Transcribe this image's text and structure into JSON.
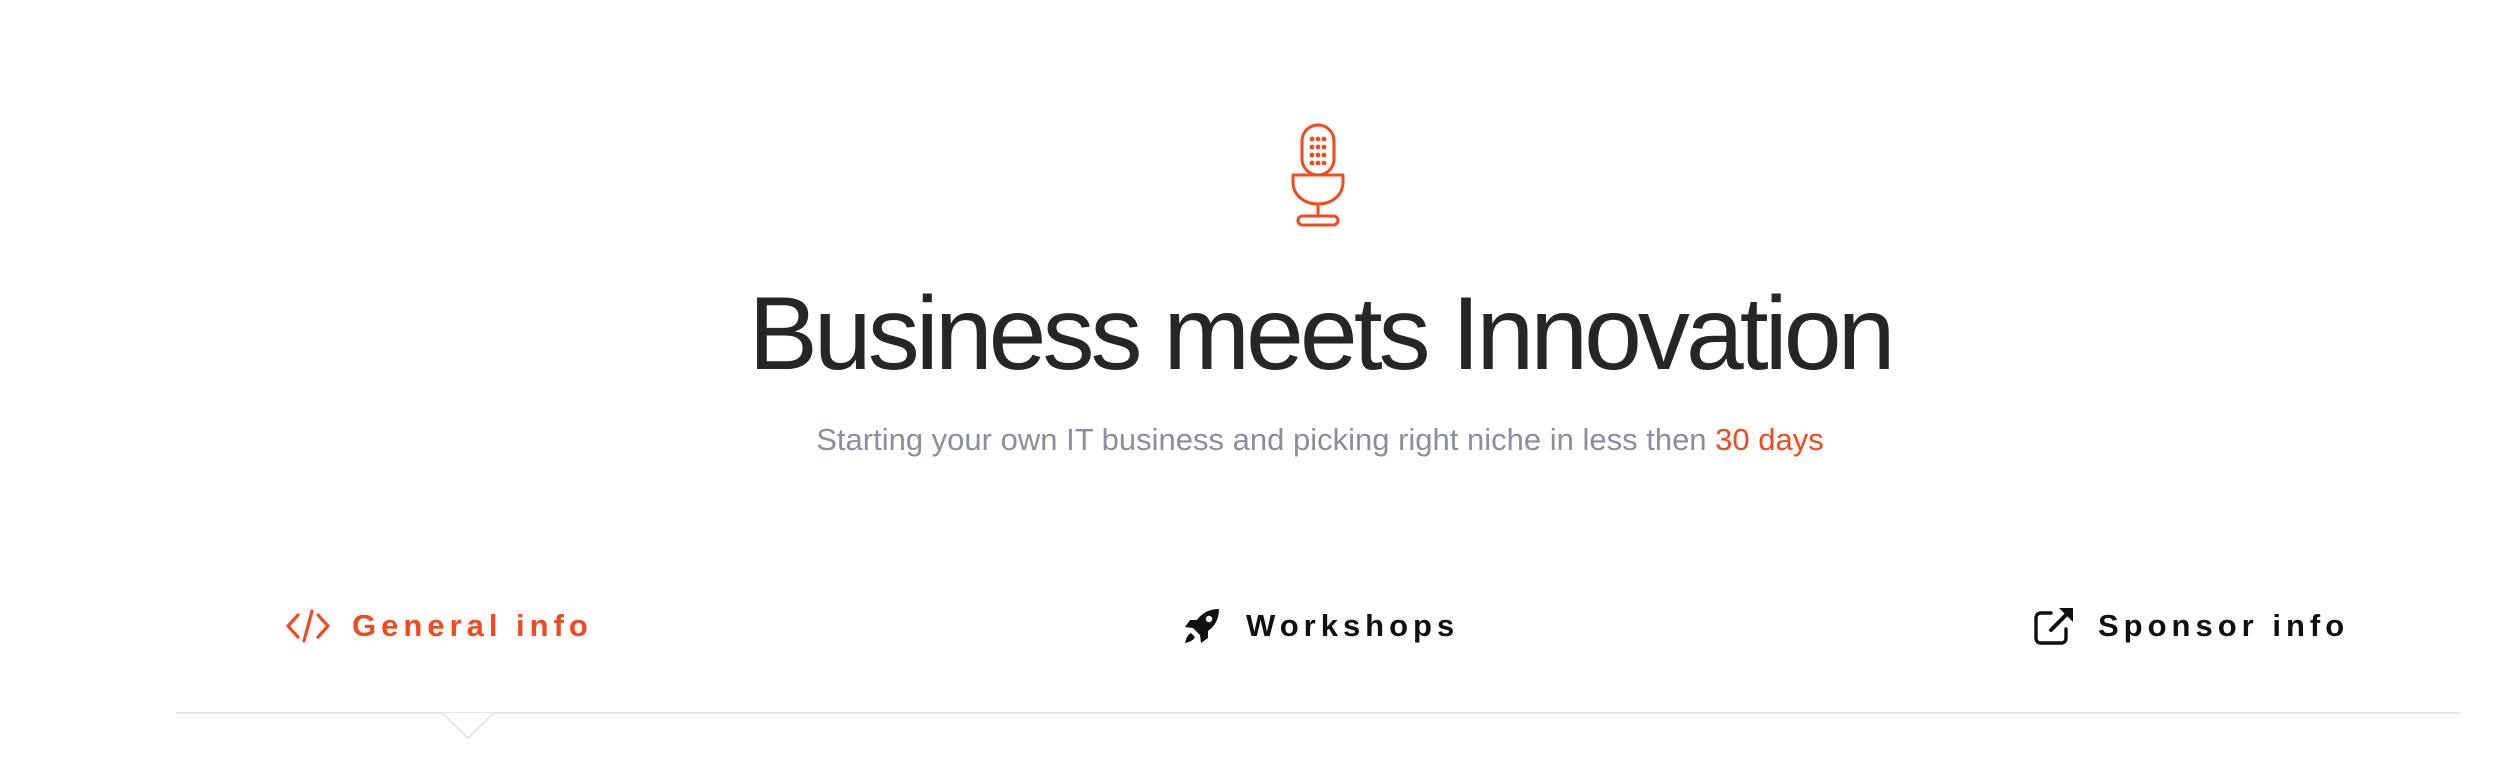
{
  "hero": {
    "icon": "microphone-icon",
    "title": "Business meets Innovation",
    "subtitle_text": "Starting your own IT business and picking right niche in less then",
    "subtitle_highlight": "30 days"
  },
  "tabs": [
    {
      "label": "General info",
      "icon": "code-icon",
      "active": true
    },
    {
      "label": "Workshops",
      "icon": "rocket-icon",
      "active": false
    },
    {
      "label": "Sponsor info",
      "icon": "external-link-icon",
      "active": false
    }
  ],
  "colors": {
    "accent": "#f04a1f",
    "title": "#262626",
    "subtitle": "#8a8f9b",
    "tab_text": "#111111",
    "divider": "#e6e6e6"
  }
}
